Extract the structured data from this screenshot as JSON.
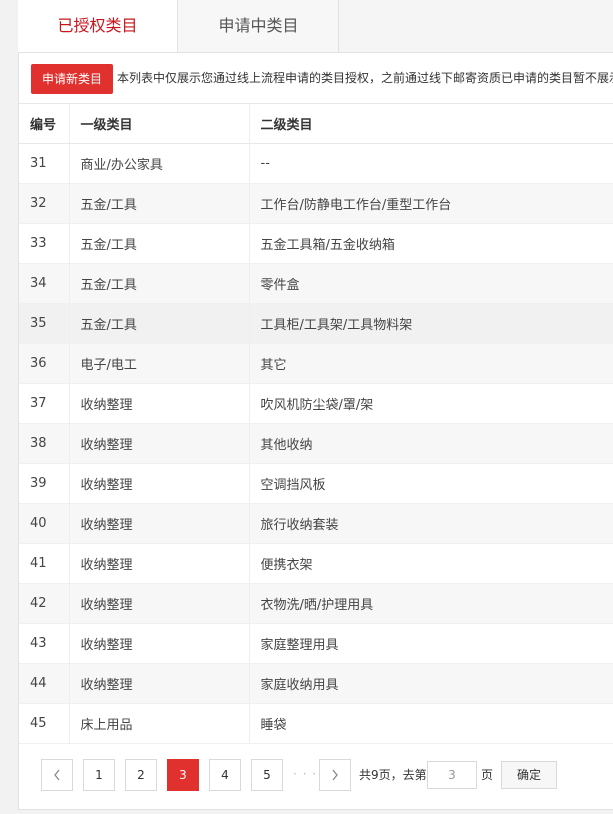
{
  "tabs": [
    {
      "label": "已授权类目"
    },
    {
      "label": "申请中类目"
    }
  ],
  "toolbar": {
    "apply_label": "申请新类目",
    "notice": "本列表中仅展示您通过线上流程申请的类目授权，之前通过线下邮寄资质已申请的类目暂不展示"
  },
  "table": {
    "headers": [
      "编号",
      "一级类目",
      "二级类目"
    ],
    "rows": [
      [
        "31",
        "商业/办公家具",
        "--"
      ],
      [
        "32",
        "五金/工具",
        "工作台/防静电工作台/重型工作台"
      ],
      [
        "33",
        "五金/工具",
        "五金工具箱/五金收纳箱"
      ],
      [
        "34",
        "五金/工具",
        "零件盒"
      ],
      [
        "35",
        "五金/工具",
        "工具柜/工具架/工具物料架"
      ],
      [
        "36",
        "电子/电工",
        "其它"
      ],
      [
        "37",
        "收纳整理",
        "吹风机防尘袋/罩/架"
      ],
      [
        "38",
        "收纳整理",
        "其他收纳"
      ],
      [
        "39",
        "收纳整理",
        "空调挡风板"
      ],
      [
        "40",
        "收纳整理",
        "旅行收纳套装"
      ],
      [
        "41",
        "收纳整理",
        "便携衣架"
      ],
      [
        "42",
        "收纳整理",
        "衣物洗/晒/护理用具"
      ],
      [
        "43",
        "收纳整理",
        "家庭整理用具"
      ],
      [
        "44",
        "收纳整理",
        "家庭收纳用具"
      ],
      [
        "45",
        "床上用品",
        "睡袋"
      ]
    ]
  },
  "pagination": {
    "prev_icon": "chevron-left-icon",
    "next_icon": "chevron-right-icon",
    "pages": [
      "1",
      "2",
      "3",
      "4",
      "5"
    ],
    "current": "3",
    "ellipsis": "· · ·",
    "total_text": "共9页，去第",
    "goto_value": "3",
    "page_suffix": "页",
    "confirm_label": "确定"
  },
  "colors": {
    "accent": "#e0312f",
    "active_tab_text": "#c8161d"
  }
}
